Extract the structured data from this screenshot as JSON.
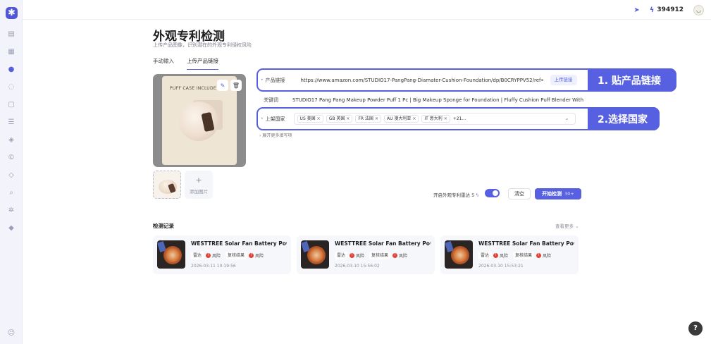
{
  "sidebar": {
    "logo": "✱",
    "icons": [
      "chart-icon",
      "grid-icon",
      "patent-icon",
      "globe-icon",
      "document-icon",
      "list-icon",
      "shield-icon",
      "copyright-icon",
      "layers-icon",
      "search-icon",
      "settings-icon",
      "tag-icon"
    ],
    "bottom_icon": "user-icon"
  },
  "topbar": {
    "credits": "394912"
  },
  "header": {
    "title": "外观专利检测",
    "subtitle": "上传产品图像，识别潜在的外观专利侵权风险"
  },
  "tabs": [
    {
      "label": "手动输入",
      "active": false
    },
    {
      "label": "上传产品链接",
      "active": true
    }
  ],
  "image_panel": {
    "packaging_text": "PUFF CASE INCLUDE",
    "add_image_label": "添加图片"
  },
  "form": {
    "url_label": "产品链接",
    "url_value": "https://www.amazon.com/STUDIO17-PangPang-Diamater-Cushion-Foundation/dp/B0CRYPPV52/ref=sr_",
    "upload_link_button": "上传链接",
    "keyword_label": "关键词",
    "keyword_value": "STUDIO17 Pang Pang Makeup Powder Puff 1 Pc | Big Makeup Sponge for Foundation | Fluffy Cushion Puff Blender With",
    "country_label": "上架国家",
    "countries": [
      "US 美国",
      "GB 英国",
      "FR 法国",
      "AU 澳大利亚",
      "IT 意大利"
    ],
    "more_countries": "+21...",
    "expand_more": "展开更多填写项"
  },
  "callouts": {
    "step1": "1. 贴产品链接",
    "step2": "2.选择国家"
  },
  "actions": {
    "radar_label": "开启外观专利雷达 5",
    "radar_enabled": true,
    "clear_button": "清空",
    "start_button": "开始检测",
    "start_cost": "30+"
  },
  "history": {
    "title": "检测记录",
    "view_more": "查看更多 ⌄",
    "records": [
      {
        "title": "WESTTREE Solar Fan Battery Powered...",
        "tag1": "雷达",
        "risk1": "风险",
        "tag2": "复核结果",
        "risk2": "风险",
        "time": "2026-03-11 10:19:56"
      },
      {
        "title": "WESTTREE Solar Fan Battery Powered...",
        "tag1": "雷达",
        "risk1": "风险",
        "tag2": "复核结果",
        "risk2": "风险",
        "time": "2026-03-10 15:56:02"
      },
      {
        "title": "WESTTREE Solar Fan Battery Powered...",
        "tag1": "雷达",
        "risk1": "风险",
        "tag2": "复核结果",
        "risk2": "风险",
        "time": "2026-03-10 15:53:21"
      }
    ]
  },
  "help": {
    "label": "?"
  },
  "colors": {
    "accent": "#5660e0",
    "risk": "#e0453a"
  }
}
